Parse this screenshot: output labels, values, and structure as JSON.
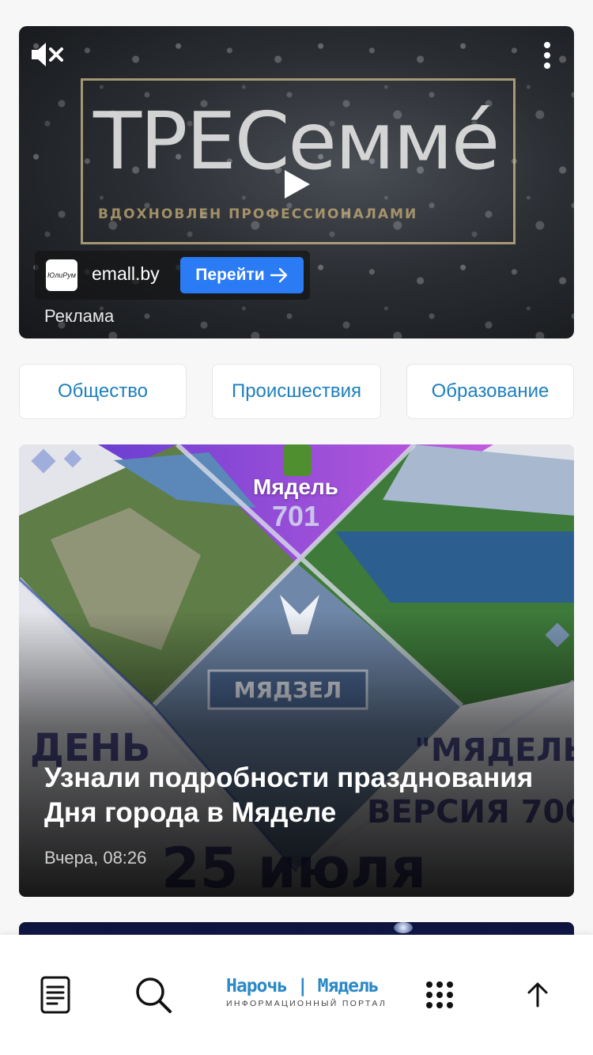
{
  "ad": {
    "brand_text": "TPECeммé",
    "brand_subtitle": "ВДОХНОВЛЕН ПРОФЕССИОНАЛАМИ",
    "advertiser_logo_text": "ЮлиРум",
    "advertiser_name": "emall.by",
    "cta_label": "Перейти",
    "ad_label": "Реклама",
    "cta_color": "#2a7bf4"
  },
  "categories": [
    {
      "label": "Общество"
    },
    {
      "label": "Происшествия"
    },
    {
      "label": "Образование"
    }
  ],
  "news": [
    {
      "image_text": {
        "city": "Мядель",
        "years": "701"
      },
      "title": "Узнали подробности празднования Дня города в Мяделе",
      "time": "Вчера, 08:26"
    }
  ],
  "bottom_bar": {
    "logo_title": "Нарочь | Мядель",
    "logo_subtitle": "ИНФОРМАЦИОННЫЙ ПОРТАЛ",
    "icons": [
      "document-icon",
      "search-icon",
      "grid-menu-icon",
      "arrow-up-icon"
    ],
    "accent_color": "#2a89c6"
  }
}
